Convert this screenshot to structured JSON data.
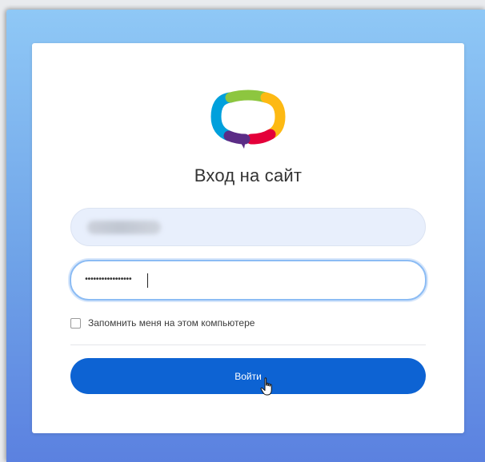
{
  "login": {
    "title": "Вход на сайт",
    "username": {
      "value": "",
      "obscured": true
    },
    "password": {
      "value": "•••••••••••••••••"
    },
    "remember": {
      "label": "Запомнить меня на этом компьютере",
      "checked": false
    },
    "submit_label": "Войти"
  },
  "logo": {
    "icon": "speech-bubble-logo-icon",
    "colors": [
      "#8dc63f",
      "#00a0dc",
      "#5b2c86",
      "#e4003a",
      "#fdb913"
    ]
  },
  "colors": {
    "accent": "#0d63d3",
    "field_focus": "#8cbcf4",
    "field_fill": "#e8effc"
  },
  "cursor": {
    "icon": "hand-pointer-icon"
  }
}
